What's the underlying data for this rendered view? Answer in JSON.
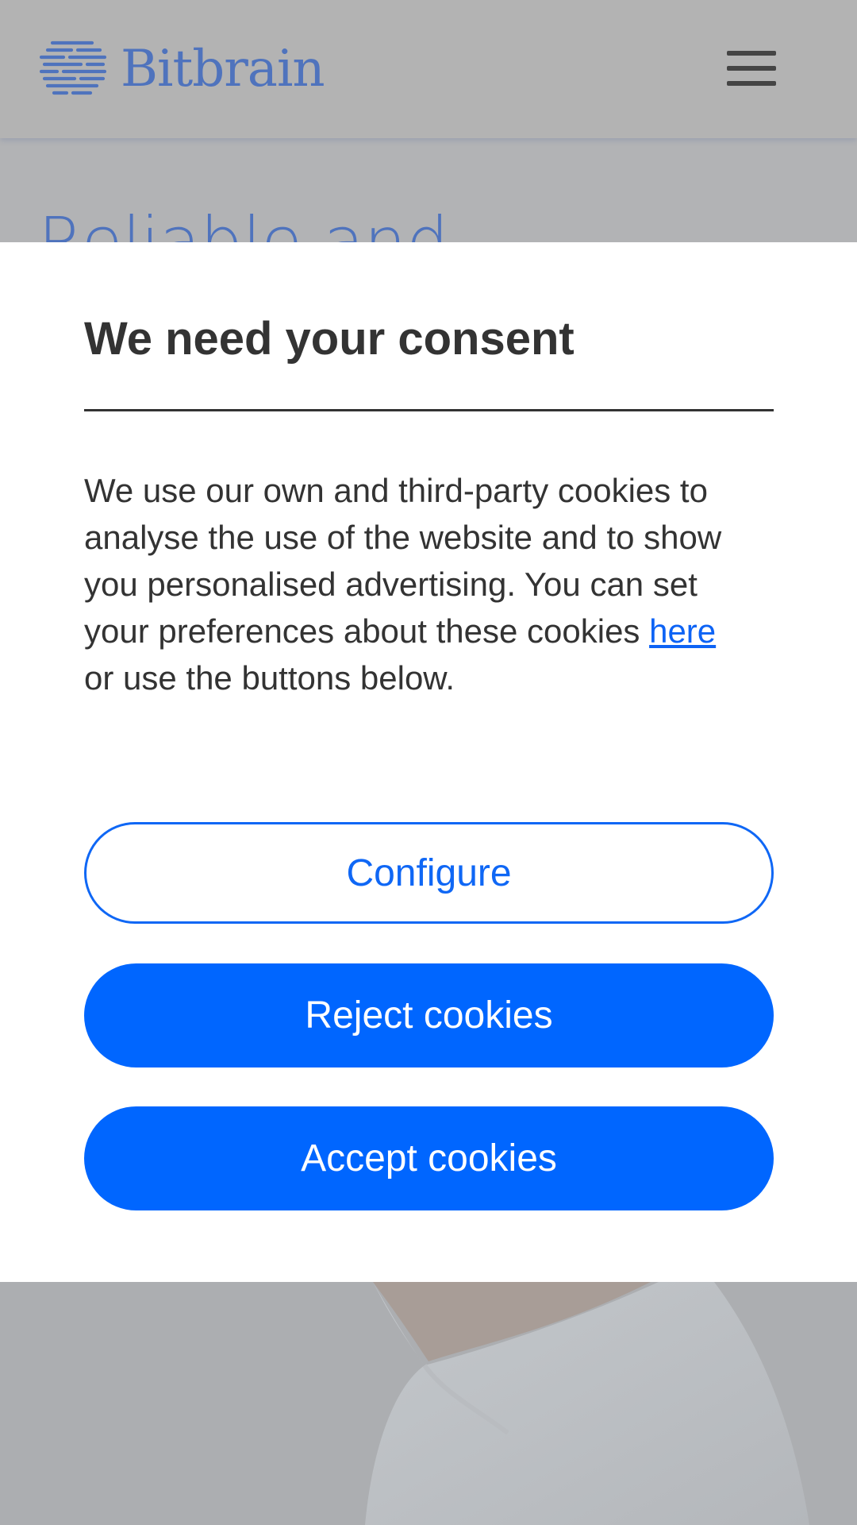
{
  "header": {
    "logo_text": "Bitbrain",
    "menu_icon": "hamburger-menu-icon"
  },
  "hero": {
    "title_partial": "Reliable and"
  },
  "consent": {
    "title": "We need your consent",
    "text_lines": [
      "We use our own and third-party cookies to",
      "analyse the use of the website and to show",
      "you personalised advertising. You can set",
      "your preferences about these cookies ",
      "or use the buttons below."
    ],
    "link_text": "here",
    "configure_label": "Configure",
    "reject_label": "Reject cookies",
    "accept_label": "Accept cookies"
  },
  "colors": {
    "accent": "#0066ff",
    "brand": "#4f73bd",
    "overlay": "#b3b3b3",
    "text": "#333333"
  }
}
